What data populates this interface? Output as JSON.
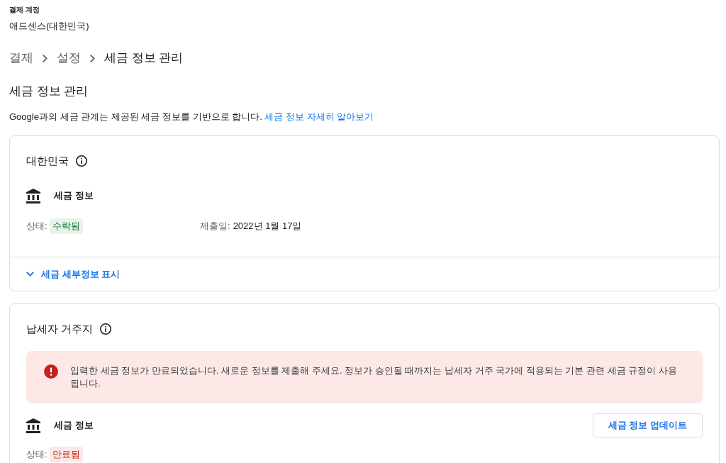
{
  "account": {
    "label": "결제 계정",
    "name": "애드센스(대한민국)"
  },
  "breadcrumb": [
    {
      "label": "결제",
      "current": false
    },
    {
      "label": "설정",
      "current": false
    },
    {
      "label": "세금 정보 관리",
      "current": true
    }
  ],
  "page": {
    "title": "세금 정보 관리",
    "description": "Google과의 세금 관계는 제공된 세금 정보를 기반으로 합니다.",
    "link": "세금 정보 자세히 알아보기"
  },
  "sections": [
    {
      "title": "대한민국",
      "item": {
        "title": "세금 정보",
        "status_label": "상태:",
        "status": {
          "text": "수락됨",
          "kind": "accepted"
        },
        "submitted_label": "제출일:",
        "submitted_value": "2022년 1월 17일"
      },
      "expand_link": "세금 세부정보 표시"
    },
    {
      "title": "납세자 거주지",
      "alert": {
        "kind": "error",
        "text": "입력한 세금 정보가 만료되었습니다. 새로운 정보를 제출해 주세요. 정보가 승인될 때까지는 납세자 거주 국가에 적용되는 기본 관련 세금 규정이 사용됩니다."
      },
      "item": {
        "title": "세금 정보",
        "status_label": "상태:",
        "status": {
          "text": "만료됨",
          "kind": "expired"
        },
        "button": "세금 정보 업데이트"
      }
    }
  ]
}
